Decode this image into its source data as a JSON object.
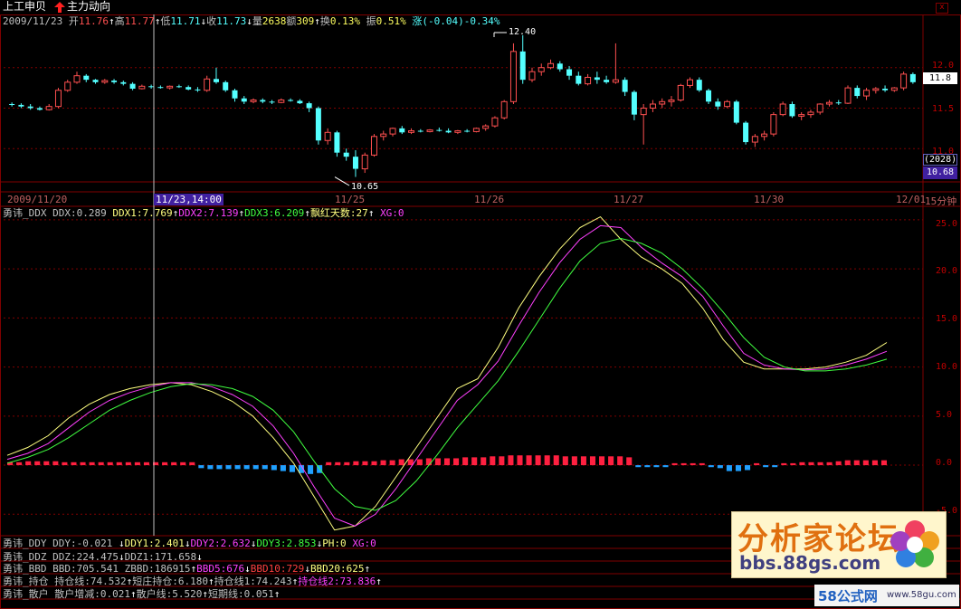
{
  "header": {
    "stock_name": "上工申贝",
    "function_name": "主力动向",
    "close_label": "x"
  },
  "quote": {
    "date": "2009/11/23",
    "open_label": "开",
    "open": "11.76",
    "high_label": "高",
    "high": "11.77",
    "low_label": "低",
    "low": "11.71",
    "close_label": "收",
    "close": "11.73",
    "vol_label": "量",
    "vol": "2638",
    "amt_label": "额",
    "amt": "309",
    "turn_label": "换",
    "turn": "0.13%",
    "amp_label": "振",
    "amp": "0.51%",
    "chg_label": "涨",
    "chg": "(-0.04)-0.34%"
  },
  "price_axis": {
    "ticks": [
      "12.0",
      "11.5",
      "11.0"
    ],
    "current_price": "11.8",
    "vol_readout": "(2028)",
    "low_readout": "10.68",
    "high_marker": "12.40",
    "low_marker": "10.65"
  },
  "date_axis": {
    "labels": [
      "2009/11/20",
      "11/25",
      "11/26",
      "11/27",
      "11/30",
      "12/01",
      "15分钟"
    ],
    "cursor": "11/23,14:00"
  },
  "ddx_panel": {
    "name": "勇讳_DDX",
    "ddx": "DDX:0.289",
    "ddx1": "DDX1:7.769",
    "ddx2": "DDX2:7.139",
    "ddx3": "DDX3:6.209",
    "red_days": "飘红天数:27",
    "xg": "XG:0",
    "ticks": [
      "25.0",
      "20.0",
      "15.0",
      "10.0",
      "5.0",
      "0.0",
      "-5.0"
    ]
  },
  "rows": {
    "ddy": {
      "name": "勇讳_DDY",
      "a": "DDY:-0.021",
      "b": "DDY1:2.401",
      "c": "DDY2:2.632",
      "d": "DDY3:2.853",
      "e": "PH:0",
      "f": "XG:0"
    },
    "ddz": {
      "name": "勇讳_DDZ",
      "a": "DDZ:224.475",
      "b": "DDZ1:171.658"
    },
    "bbd": {
      "name": "勇讳_BBD",
      "a": "BBD:705.541",
      "b": "ZBBD:186915",
      "c": "BBD5:676",
      "d": "BBD10:729",
      "e": "BBD20:625"
    },
    "hold": {
      "name": "勇讳_持仓",
      "a": "持仓线:74.532",
      "b": "短庄持仓:6.180",
      "c": "持仓线1:74.243",
      "d": "持仓线2:73.836"
    },
    "retail": {
      "name": "勇讳_散户",
      "a": "散户增减:0.021",
      "b": "散户线:5.520",
      "c": "短期线:0.051"
    }
  },
  "watermark": {
    "title": "分析家论坛",
    "url": "bbs.88gs.com",
    "logo2": "58公式网",
    "url2": "www.58gu.com"
  },
  "colors": {
    "up": "#ff5050",
    "down": "#54ffff",
    "ddx1": "#ffff80",
    "ddx2": "#ff40ff",
    "ddx3": "#40ff40",
    "grid": "#800000"
  },
  "chart_data": [
    {
      "type": "candlestick",
      "title": "上工申贝 15分钟",
      "y_range": [
        10.6,
        12.5
      ],
      "ohlc": [
        [
          11.55,
          11.57,
          11.52,
          11.54
        ],
        [
          11.54,
          11.56,
          11.5,
          11.52
        ],
        [
          11.52,
          11.55,
          11.48,
          11.5
        ],
        [
          11.5,
          11.52,
          11.47,
          11.48
        ],
        [
          11.48,
          11.55,
          11.47,
          11.52
        ],
        [
          11.52,
          11.75,
          11.5,
          11.72
        ],
        [
          11.72,
          11.85,
          11.7,
          11.82
        ],
        [
          11.82,
          11.95,
          11.8,
          11.9
        ],
        [
          11.9,
          11.92,
          11.82,
          11.85
        ],
        [
          11.85,
          11.86,
          11.8,
          11.82
        ],
        [
          11.82,
          11.86,
          11.8,
          11.84
        ],
        [
          11.84,
          11.86,
          11.8,
          11.82
        ],
        [
          11.82,
          11.84,
          11.78,
          11.8
        ],
        [
          11.8,
          11.82,
          11.72,
          11.74
        ],
        [
          11.74,
          11.79,
          11.73,
          11.77
        ],
        [
          11.77,
          11.79,
          11.74,
          11.76
        ],
        [
          11.76,
          11.78,
          11.74,
          11.75
        ],
        [
          11.75,
          11.78,
          11.73,
          11.77
        ],
        [
          11.77,
          11.79,
          11.75,
          11.76
        ],
        [
          11.76,
          11.78,
          11.72,
          11.73
        ],
        [
          11.73,
          11.76,
          11.7,
          11.72
        ],
        [
          11.72,
          11.9,
          11.7,
          11.86
        ],
        [
          11.86,
          12.0,
          11.8,
          11.82
        ],
        [
          11.82,
          11.84,
          11.7,
          11.72
        ],
        [
          11.72,
          11.74,
          11.58,
          11.62
        ],
        [
          11.62,
          11.65,
          11.55,
          11.58
        ],
        [
          11.58,
          11.62,
          11.56,
          11.6
        ],
        [
          11.6,
          11.62,
          11.56,
          11.58
        ],
        [
          11.58,
          11.6,
          11.55,
          11.57
        ],
        [
          11.57,
          11.62,
          11.56,
          11.6
        ],
        [
          11.6,
          11.62,
          11.58,
          11.59
        ],
        [
          11.59,
          11.61,
          11.55,
          11.56
        ],
        [
          11.56,
          11.58,
          11.45,
          11.5
        ],
        [
          11.5,
          11.52,
          11.05,
          11.1
        ],
        [
          11.1,
          11.25,
          11.05,
          11.2
        ],
        [
          11.2,
          11.22,
          10.9,
          10.95
        ],
        [
          10.95,
          11.0,
          10.85,
          10.9
        ],
        [
          10.9,
          10.98,
          10.65,
          10.75
        ],
        [
          10.75,
          10.95,
          10.7,
          10.92
        ],
        [
          10.92,
          11.18,
          10.9,
          11.15
        ],
        [
          11.15,
          11.22,
          11.1,
          11.18
        ],
        [
          11.18,
          11.26,
          11.15,
          11.25
        ],
        [
          11.25,
          11.28,
          11.18,
          11.2
        ],
        [
          11.2,
          11.25,
          11.18,
          11.22
        ],
        [
          11.22,
          11.24,
          11.2,
          11.21
        ],
        [
          11.21,
          11.24,
          11.2,
          11.23
        ],
        [
          11.23,
          11.26,
          11.21,
          11.22
        ],
        [
          11.22,
          11.25,
          11.19,
          11.2
        ],
        [
          11.2,
          11.23,
          11.18,
          11.22
        ],
        [
          11.22,
          11.24,
          11.2,
          11.21
        ],
        [
          11.21,
          11.26,
          11.2,
          11.25
        ],
        [
          11.25,
          11.3,
          11.22,
          11.28
        ],
        [
          11.28,
          11.4,
          11.26,
          11.38
        ],
        [
          11.38,
          11.6,
          11.36,
          11.58
        ],
        [
          11.58,
          12.3,
          11.55,
          12.2
        ],
        [
          12.2,
          12.4,
          11.8,
          11.85
        ],
        [
          11.85,
          12.0,
          11.82,
          11.95
        ],
        [
          11.95,
          12.05,
          11.9,
          12.0
        ],
        [
          12.0,
          12.1,
          11.98,
          12.05
        ],
        [
          12.05,
          12.08,
          11.95,
          11.98
        ],
        [
          11.98,
          12.02,
          11.85,
          11.9
        ],
        [
          11.9,
          11.95,
          11.78,
          11.8
        ],
        [
          11.8,
          11.92,
          11.78,
          11.88
        ],
        [
          11.88,
          11.95,
          11.8,
          11.85
        ],
        [
          11.85,
          11.9,
          11.8,
          11.82
        ],
        [
          11.82,
          12.3,
          11.8,
          11.85
        ],
        [
          11.85,
          11.88,
          11.65,
          11.7
        ],
        [
          11.7,
          11.72,
          11.35,
          11.42
        ],
        [
          11.42,
          11.55,
          11.05,
          11.5
        ],
        [
          11.5,
          11.6,
          11.45,
          11.55
        ],
        [
          11.55,
          11.62,
          11.5,
          11.58
        ],
        [
          11.58,
          11.65,
          11.52,
          11.6
        ],
        [
          11.6,
          11.8,
          11.58,
          11.78
        ],
        [
          11.78,
          11.88,
          11.75,
          11.85
        ],
        [
          11.85,
          11.88,
          11.7,
          11.72
        ],
        [
          11.72,
          11.74,
          11.55,
          11.58
        ],
        [
          11.58,
          11.62,
          11.48,
          11.52
        ],
        [
          11.52,
          11.6,
          11.5,
          11.58
        ],
        [
          11.58,
          11.6,
          11.3,
          11.32
        ],
        [
          11.32,
          11.34,
          11.05,
          11.08
        ],
        [
          11.08,
          11.18,
          11.02,
          11.15
        ],
        [
          11.15,
          11.22,
          11.1,
          11.18
        ],
        [
          11.18,
          11.45,
          11.15,
          11.42
        ],
        [
          11.42,
          11.58,
          11.4,
          11.55
        ],
        [
          11.55,
          11.58,
          11.38,
          11.4
        ],
        [
          11.4,
          11.45,
          11.35,
          11.42
        ],
        [
          11.42,
          11.48,
          11.38,
          11.45
        ],
        [
          11.45,
          11.56,
          11.42,
          11.55
        ],
        [
          11.55,
          11.6,
          11.52,
          11.57
        ],
        [
          11.57,
          11.6,
          11.54,
          11.56
        ],
        [
          11.56,
          11.78,
          11.55,
          11.75
        ],
        [
          11.75,
          11.78,
          11.62,
          11.65
        ],
        [
          11.65,
          11.75,
          11.6,
          11.72
        ],
        [
          11.72,
          11.76,
          11.68,
          11.74
        ],
        [
          11.74,
          11.78,
          11.7,
          11.72
        ],
        [
          11.72,
          11.76,
          11.7,
          11.75
        ],
        [
          11.75,
          11.95,
          11.72,
          11.92
        ],
        [
          11.92,
          11.94,
          11.8,
          11.82
        ]
      ]
    },
    {
      "type": "line",
      "title": "勇讳_DDX",
      "y_range": [
        -7,
        26
      ],
      "series": [
        {
          "name": "DDX1",
          "color": "#ffff80",
          "values": [
            1.0,
            1.8,
            3.0,
            4.8,
            6.2,
            7.2,
            7.8,
            8.2,
            8.4,
            8.2,
            7.5,
            6.5,
            5.0,
            2.8,
            0.2,
            -3.2,
            -6.6,
            -6.2,
            -4.2,
            -1.2,
            1.8,
            4.8,
            7.8,
            8.8,
            12.0,
            16.0,
            19.2,
            22.0,
            24.2,
            25.3,
            23.0,
            21.2,
            20.0,
            18.5,
            16.0,
            12.8,
            10.5,
            9.8,
            9.8,
            9.8,
            10.0,
            10.5,
            11.2,
            12.5
          ]
        },
        {
          "name": "DDX2",
          "color": "#ff40ff",
          "values": [
            0.6,
            1.2,
            2.2,
            3.8,
            5.4,
            6.6,
            7.4,
            8.0,
            8.4,
            8.4,
            8.0,
            7.2,
            6.0,
            4.0,
            1.2,
            -2.2,
            -5.4,
            -6.2,
            -5.0,
            -2.4,
            0.6,
            3.6,
            6.6,
            8.2,
            10.6,
            14.2,
            17.6,
            20.6,
            23.0,
            24.4,
            24.2,
            22.2,
            20.6,
            19.2,
            17.2,
            14.2,
            11.4,
            10.2,
            9.8,
            9.7,
            9.8,
            10.2,
            10.8,
            11.6
          ]
        },
        {
          "name": "DDX3",
          "color": "#40ff40",
          "values": [
            0.2,
            0.8,
            1.6,
            2.8,
            4.2,
            5.6,
            6.6,
            7.4,
            8.0,
            8.3,
            8.2,
            7.8,
            7.0,
            5.6,
            3.4,
            0.4,
            -2.4,
            -4.2,
            -4.6,
            -3.6,
            -1.6,
            1.0,
            3.8,
            6.2,
            8.6,
            11.6,
            14.8,
            18.0,
            20.8,
            22.6,
            23.1,
            22.6,
            21.6,
            20.0,
            18.0,
            15.6,
            13.0,
            11.0,
            10.0,
            9.6,
            9.6,
            9.8,
            10.2,
            10.8
          ]
        }
      ],
      "bars": [
        0.3,
        0.3,
        0.4,
        0.4,
        0.4,
        0.4,
        0.3,
        0.3,
        0.3,
        0.3,
        0.3,
        0.3,
        0.3,
        0.3,
        0.3,
        0.3,
        0.3,
        0.3,
        0.3,
        0.3,
        0.3,
        -0.3,
        -0.4,
        -0.4,
        -0.4,
        -0.4,
        -0.4,
        -0.4,
        -0.4,
        -0.5,
        -0.6,
        -0.7,
        -0.8,
        -0.9,
        -0.8,
        0.3,
        0.3,
        0.3,
        0.4,
        0.4,
        0.4,
        0.5,
        0.5,
        0.6,
        0.6,
        0.6,
        0.7,
        0.7,
        0.7,
        0.7,
        0.8,
        0.8,
        0.8,
        0.9,
        0.9,
        1.0,
        1.0,
        1.0,
        1.0,
        1.0,
        1.0,
        0.9,
        0.9,
        0.9,
        0.9,
        0.9,
        0.9,
        0.9,
        0.8,
        -0.2,
        -0.2,
        -0.2,
        -0.2,
        0.2,
        0.2,
        0.2,
        0.2,
        -0.2,
        -0.3,
        -0.6,
        -0.6,
        -0.5,
        0.2,
        -0.2,
        -0.2,
        0.2,
        0.2,
        0.3,
        0.3,
        0.3,
        0.3,
        0.4,
        0.5,
        0.5,
        0.5,
        0.5,
        0.5
      ]
    }
  ]
}
